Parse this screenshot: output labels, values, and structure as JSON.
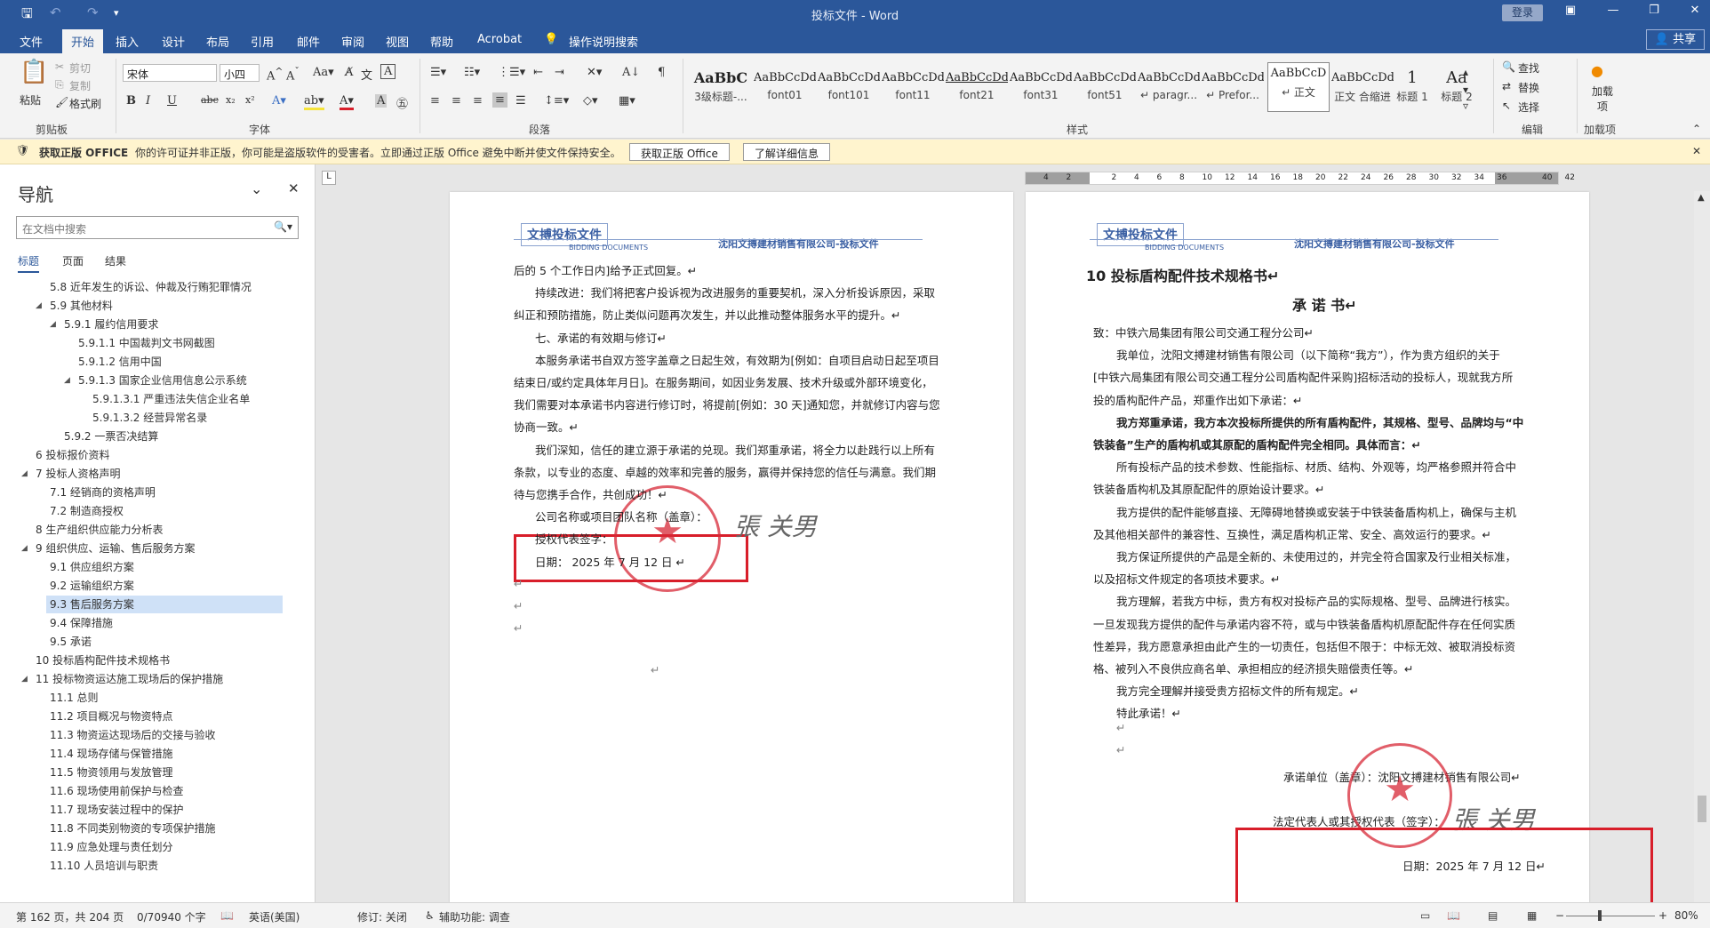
{
  "titlebar": {
    "title": "投标文件  -  Word",
    "login": "登录"
  },
  "tabs": [
    "文件",
    "开始",
    "插入",
    "设计",
    "布局",
    "引用",
    "邮件",
    "审阅",
    "视图",
    "帮助",
    "Acrobat"
  ],
  "tell_me": "操作说明搜索",
  "share": "共享",
  "ribbon": {
    "clipboard": {
      "paste": "粘贴",
      "cut": "剪切",
      "copy": "复制",
      "format_painter": "格式刷",
      "label": "剪贴板"
    },
    "font": {
      "name": "宋体",
      "size": "小四",
      "label": "字体"
    },
    "paragraph": {
      "label": "段落"
    },
    "styles": {
      "label": "样式",
      "items": [
        {
          "preview": "AaBbC",
          "name": "3级标题-..."
        },
        {
          "preview": "AaBbCcDdI",
          "name": "font01"
        },
        {
          "preview": "AaBbCcDdI",
          "name": "font101"
        },
        {
          "preview": "AaBbCcDdI",
          "name": "font11"
        },
        {
          "preview": "AaBbCcDd",
          "name": "font21"
        },
        {
          "preview": "AaBbCcDdI",
          "name": "font31"
        },
        {
          "preview": "AaBbCcDdI",
          "name": "font51"
        },
        {
          "preview": "AaBbCcDd",
          "name": "↵ paragr..."
        },
        {
          "preview": "AaBbCcDd",
          "name": "↵ Prefor..."
        },
        {
          "preview": "AaBbCcD",
          "name": "↵ 正文"
        },
        {
          "preview": "AaBbCcDd",
          "name": "正文 合缩进"
        },
        {
          "preview": "1",
          "name": "标题 1"
        },
        {
          "preview": "Aa",
          "name": "标题 2"
        }
      ]
    },
    "editing": {
      "find": "查找",
      "replace": "替换",
      "select": "选择",
      "label": "编辑"
    },
    "addins": {
      "add": "加载项",
      "label": "加载项"
    }
  },
  "msgbar": {
    "title": "获取正版 OFFICE",
    "text": "你的许可证并非正版，你可能是盗版软件的受害者。立即通过正版 Office 避免中断并使文件保持安全。",
    "btn1": "获取正版 Office",
    "btn2": "了解详细信息"
  },
  "nav": {
    "title": "导航",
    "search_placeholder": "在文档中搜索",
    "tabs": [
      "标题",
      "页面",
      "结果"
    ],
    "items": [
      {
        "level": 2,
        "text": "5.8 近年发生的诉讼、仲裁及行贿犯罪情况",
        "expand": ""
      },
      {
        "level": 2,
        "text": "5.9 其他材料",
        "expand": "◢"
      },
      {
        "level": 3,
        "text": "5.9.1 履约信用要求",
        "expand": "◢"
      },
      {
        "level": 4,
        "text": "5.9.1.1 中国裁判文书网截图",
        "expand": ""
      },
      {
        "level": 4,
        "text": "5.9.1.2 信用中国",
        "expand": ""
      },
      {
        "level": 4,
        "text": "5.9.1.3 国家企业信用信息公示系统",
        "expand": "◢"
      },
      {
        "level": 5,
        "text": "5.9.1.3.1 严重违法失信企业名单",
        "expand": ""
      },
      {
        "level": 5,
        "text": "5.9.1.3.2 经营异常名录",
        "expand": ""
      },
      {
        "level": 3,
        "text": "5.9.2 一票否决结算",
        "expand": ""
      },
      {
        "level": 1,
        "text": "6 投标报价资料",
        "expand": ""
      },
      {
        "level": 1,
        "text": "7 投标人资格声明",
        "expand": "◢"
      },
      {
        "level": 2,
        "text": "7.1 经销商的资格声明",
        "expand": ""
      },
      {
        "level": 2,
        "text": "7.2 制造商授权",
        "expand": ""
      },
      {
        "level": 1,
        "text": "8 生产组织供应能力分析表",
        "expand": ""
      },
      {
        "level": 1,
        "text": "9 组织供应、运输、售后服务方案",
        "expand": "◢"
      },
      {
        "level": 2,
        "text": "9.1 供应组织方案",
        "expand": ""
      },
      {
        "level": 2,
        "text": "9.2 运输组织方案",
        "expand": ""
      },
      {
        "level": 2,
        "text": "9.3 售后服务方案",
        "expand": "",
        "selected": true
      },
      {
        "level": 2,
        "text": "9.4 保障措施",
        "expand": ""
      },
      {
        "level": 2,
        "text": "9.5 承诺",
        "expand": ""
      },
      {
        "level": 1,
        "text": "10 投标盾构配件技术规格书",
        "expand": ""
      },
      {
        "level": 1,
        "text": "11 投标物资运达施工现场后的保护措施",
        "expand": "◢"
      },
      {
        "level": 2,
        "text": "11.1 总则",
        "expand": ""
      },
      {
        "level": 2,
        "text": "11.2 项目概况与物资特点",
        "expand": ""
      },
      {
        "level": 2,
        "text": "11.3 物资运达现场后的交接与验收",
        "expand": ""
      },
      {
        "level": 2,
        "text": "11.4 现场存储与保管措施",
        "expand": ""
      },
      {
        "level": 2,
        "text": "11.5 物资领用与发放管理",
        "expand": ""
      },
      {
        "level": 2,
        "text": "11.6 现场使用前保护与检查",
        "expand": ""
      },
      {
        "level": 2,
        "text": "11.7 现场安装过程中的保护",
        "expand": ""
      },
      {
        "level": 2,
        "text": "11.8 不同类别物资的专项保护措施",
        "expand": ""
      },
      {
        "level": 2,
        "text": "11.9 应急处理与责任划分",
        "expand": ""
      },
      {
        "level": 2,
        "text": "11.10 人员培训与职责",
        "expand": ""
      }
    ]
  },
  "ruler": [
    "4",
    "2",
    "",
    "2",
    "4",
    "6",
    "8",
    "10",
    "12",
    "14",
    "16",
    "18",
    "20",
    "22",
    "24",
    "26",
    "28",
    "30",
    "32",
    "34",
    "36",
    "",
    "40",
    "42"
  ],
  "page_left": {
    "logo": "文搏投标文件",
    "logo_sub": "BIDDING DOCUMENTS",
    "company": "沈阳文搏建材销售有限公司-投标文件",
    "lines": [
      "后的 5 个工作日内]给予正式回复。↵",
      "持续改进：我们将把客户投诉视为改进服务的重要契机，深入分析投诉原因，采取",
      "纠正和预防措施，防止类似问题再次发生，并以此推动整体服务水平的提升。↵",
      "七、承诺的有效期与修订↵",
      "本服务承诺书自双方签字盖章之日起生效，有效期为[例如：自项目启动日起至项目",
      "结束日/或约定具体年月日]。在服务期间，如因业务发展、技术升级或外部环境变化，",
      "我们需要对本承诺书内容进行修订时，将提前[例如：30 天]通知您，并就修订内容与您",
      "协商一致。↵",
      "我们深知，信任的建立源于承诺的兑现。我们郑重承诺，将全力以赴践行以上所有",
      "条款，以专业的态度、卓越的效率和完善的服务，赢得并保持您的信任与满意。我们期",
      "待与您携手合作，共创成功！↵",
      "公司名称或项目团队名称（盖章）：",
      "授权代表签字：",
      "日期：     2025 年 7 月 12 日  ↵"
    ],
    "signature": "張 关男"
  },
  "page_right": {
    "logo": "文搏投标文件",
    "logo_sub": "BIDDING DOCUMENTS",
    "company": "沈阳文搏建材销售有限公司-投标文件",
    "heading": "10 投标盾构配件技术规格书↵",
    "title": "承 诺 书↵",
    "lines": [
      "致：中铁六局集团有限公司交通工程分公司↵",
      "我单位，沈阳文搏建材销售有限公司（以下简称“我方”），作为贵方组织的关于",
      "[中铁六局集团有限公司交通工程分公司盾构配件采购]招标活动的投标人，现就我方所",
      "投的盾构配件产品，郑重作出如下承诺：↵",
      "我方郑重承诺，我方本次投标所提供的所有盾构配件，其规格、型号、品牌均与“中",
      "铁装备”生产的盾构机或其原配的盾构配件完全相同。具体而言：↵",
      "所有投标产品的技术参数、性能指标、材质、结构、外观等，均严格参照并符合中",
      "铁装备盾构机及其原配配件的原始设计要求。↵",
      "我方提供的配件能够直接、无障碍地替换或安装于中铁装备盾构机上，确保与主机",
      "及其他相关部件的兼容性、互换性，满足盾构机正常、安全、高效运行的要求。↵",
      "我方保证所提供的产品是全新的、未使用过的，并完全符合国家及行业相关标准，",
      "以及招标文件规定的各项技术要求。↵",
      "我方理解，若我方中标，贵方有权对投标产品的实际规格、型号、品牌进行核实。",
      "一旦发现我方提供的配件与承诺内容不符，或与中铁装备盾构机原配配件存在任何实质",
      "性差异，我方愿意承担由此产生的一切责任，包括但不限于：中标无效、被取消投标资",
      "格、被列入不良供应商名单、承担相应的经济损失赔偿责任等。↵",
      "我方完全理解并接受贵方招标文件的所有规定。↵",
      "特此承诺！↵"
    ],
    "sign_unit": "承诺单位（盖章）：沈阳文搏建材销售有限公司↵",
    "legal_rep": "法定代表人或其授权代表（签字）：",
    "date": "日期：2025 年 7 月 12 日↵",
    "signature": "張 关男"
  },
  "status": {
    "page": "第 162 页，共 204 页",
    "words": "0/70940 个字",
    "lang": "英语(美国)",
    "track": "修订: 关闭",
    "access": "辅助功能: 调查",
    "zoom": "80%"
  },
  "colors": {
    "word_blue": "#2b579a",
    "stamp_red": "#d72837",
    "box_red": "#d81e2a",
    "msg_bg": "#fff4ce"
  }
}
